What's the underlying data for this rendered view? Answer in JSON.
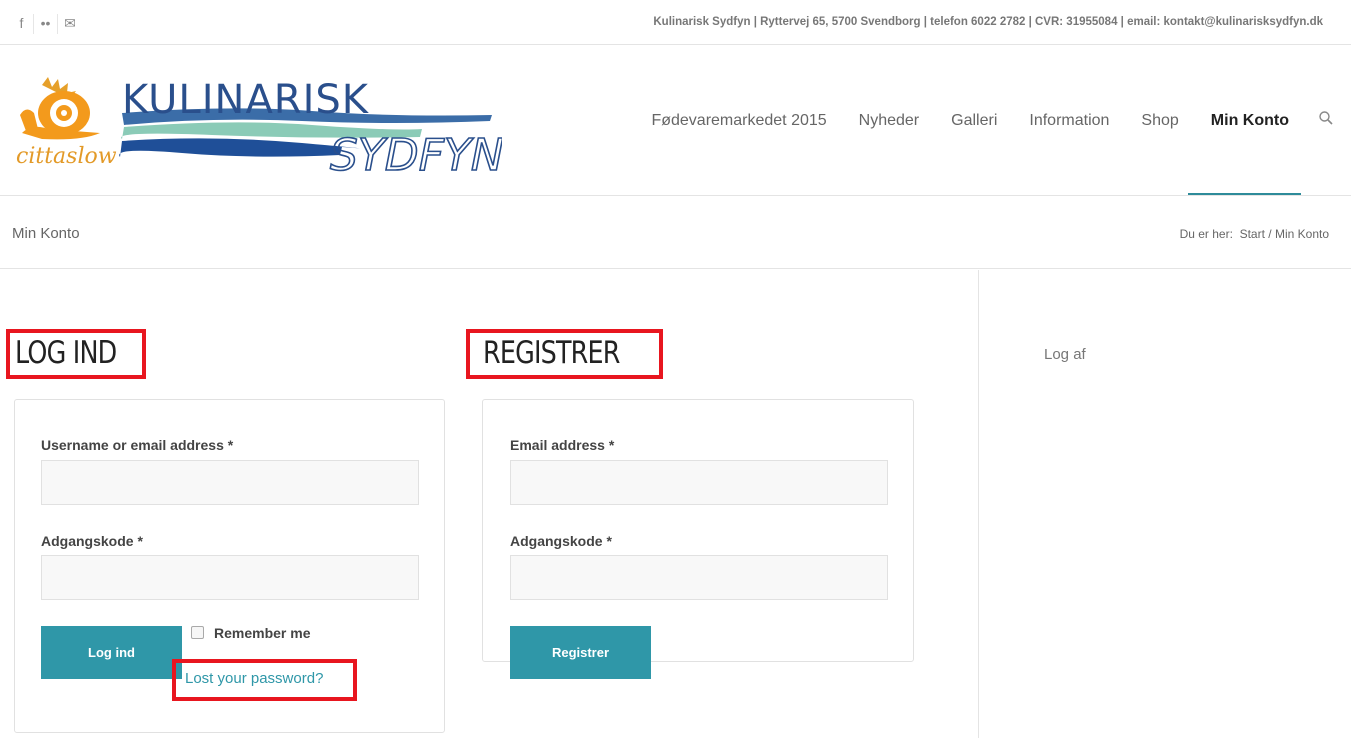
{
  "topbar": {
    "social_icons": [
      "facebook-icon",
      "flickr-icon",
      "mail-icon"
    ],
    "social_glyphs": [
      "f",
      "••",
      "✉"
    ],
    "contact": "Kulinarisk Sydfyn | Ryttervej 65, 5700 Svendborg | telefon 6022 2782 | CVR: 31955084 | email: kontakt@kulinarisksydfyn.dk"
  },
  "logo": {
    "cittaslow": "cittaslow",
    "brand_top": "KULINARISK",
    "brand_bottom": "SYDFYN"
  },
  "nav": {
    "items": [
      "Fødevaremarkedet 2015",
      "Nyheder",
      "Galleri",
      "Information",
      "Shop",
      "Min Konto"
    ],
    "active": "Min Konto",
    "search_glyph": "⚲"
  },
  "titlebar": {
    "title": "Min Konto",
    "breadcrumb_prefix": "Du er her:",
    "breadcrumb_home": "Start",
    "breadcrumb_sep": "/",
    "breadcrumb_current": "Min Konto"
  },
  "login": {
    "heading": "LOG IND",
    "username_label": "Username or email address *",
    "password_label": "Adgangskode *",
    "submit": "Log ind",
    "remember": "Remember me",
    "lost": "Lost your password?"
  },
  "register": {
    "heading": "REGISTRER",
    "email_label": "Email address *",
    "password_label": "Adgangskode *",
    "submit": "Registrer"
  },
  "sidebar": {
    "logout": "Log af"
  },
  "colors": {
    "accent": "#2f97a8",
    "highlight": "#e8161f",
    "nav_underline": "#2e8b9a"
  }
}
